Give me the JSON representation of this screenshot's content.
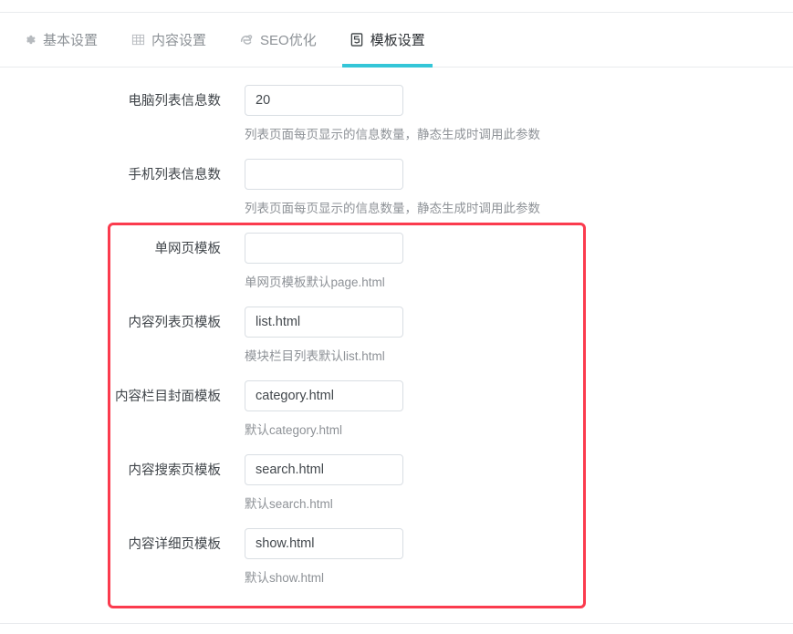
{
  "tabs": [
    {
      "label": "基本设置",
      "icon": "gear-icon",
      "active": false
    },
    {
      "label": "内容设置",
      "icon": "table-grid-icon",
      "active": false
    },
    {
      "label": "SEO优化",
      "icon": "browser-e-icon",
      "active": false
    },
    {
      "label": "模板设置",
      "icon": "html5-shield-icon",
      "active": true
    }
  ],
  "accent_color": "#34c6d8",
  "annotation_color": "#fb3b4e",
  "form": {
    "rows": [
      {
        "label": "电脑列表信息数",
        "value": "20",
        "placeholder": "",
        "help": "列表页面每页显示的信息数量，静态生成时调用此参数"
      },
      {
        "label": "手机列表信息数",
        "value": "",
        "placeholder": "",
        "help": "列表页面每页显示的信息数量，静态生成时调用此参数"
      },
      {
        "label": "单网页模板",
        "value": "",
        "placeholder": "",
        "help": "单网页模板默认page.html"
      },
      {
        "label": "内容列表页模板",
        "value": "list.html",
        "placeholder": "",
        "help": "模块栏目列表默认list.html"
      },
      {
        "label": "内容栏目封面模板",
        "value": "category.html",
        "placeholder": "",
        "help": "默认category.html"
      },
      {
        "label": "内容搜索页模板",
        "value": "search.html",
        "placeholder": "",
        "help": "默认search.html"
      },
      {
        "label": "内容详细页模板",
        "value": "show.html",
        "placeholder": "",
        "help": "默认show.html"
      }
    ]
  }
}
